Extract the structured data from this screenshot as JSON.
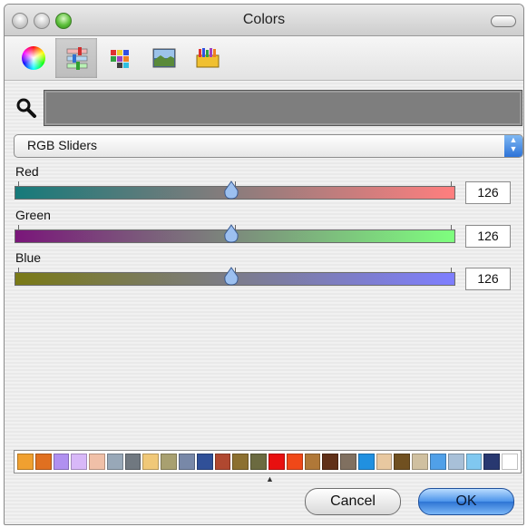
{
  "window": {
    "title": "Colors"
  },
  "toolbar": {
    "tabs": [
      {
        "icon": "color-wheel-icon"
      },
      {
        "icon": "color-sliders-icon",
        "selected": true
      },
      {
        "icon": "color-palettes-icon"
      },
      {
        "icon": "image-palettes-icon"
      },
      {
        "icon": "crayons-icon"
      }
    ]
  },
  "current_color": "#7e7e7e",
  "mode_select": {
    "selected": "RGB Sliders"
  },
  "sliders": [
    {
      "label": "Red",
      "value": "126",
      "fraction": 0.494,
      "gradient": [
        "#167a7a",
        "#ff7e7e"
      ]
    },
    {
      "label": "Green",
      "value": "126",
      "fraction": 0.494,
      "gradient": [
        "#7a167a",
        "#7eff7e"
      ]
    },
    {
      "label": "Blue",
      "value": "126",
      "fraction": 0.494,
      "gradient": [
        "#7a7a16",
        "#7e7eff"
      ]
    }
  ],
  "swatches": [
    "#f0a030",
    "#e07020",
    "#b090f0",
    "#d8b8f8",
    "#f0c0a8",
    "#98a8b8",
    "#707880",
    "#f0c878",
    "#a8a070",
    "#7888a8",
    "#305098",
    "#b04830",
    "#8c7030",
    "#6b6a40",
    "#e81010",
    "#f04818",
    "#b07838",
    "#603018",
    "#807060",
    "#2090e0",
    "#e8c8a0",
    "#705020",
    "#d0c0a0",
    "#50a0e8",
    "#a8c0d8",
    "#80c8f0",
    "#283870",
    "#ffffff"
  ],
  "buttons": {
    "cancel": "Cancel",
    "ok": "OK"
  }
}
